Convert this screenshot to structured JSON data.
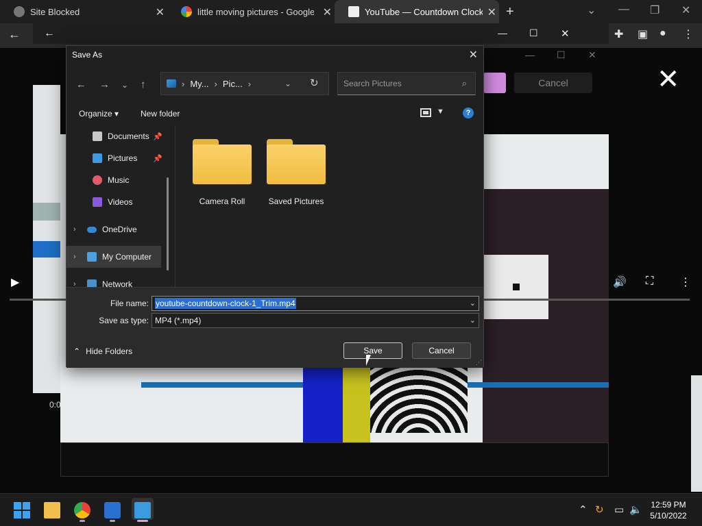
{
  "browser": {
    "tabs": [
      {
        "title": "Site Blocked",
        "color": "#888888"
      },
      {
        "title": "little moving pictures - Google S",
        "color": "#ffffff"
      },
      {
        "title": "YouTube — Countdown Clocks /",
        "color": "#e0e0e0"
      }
    ],
    "new_tab": "+"
  },
  "editor": {
    "cancel_label": "Cancel",
    "time": "0:0"
  },
  "dialog": {
    "title": "Save As",
    "breadcrumb": [
      "My...",
      "Pic...",
      ""
    ],
    "search_placeholder": "Search Pictures",
    "organize_label": "Organize",
    "new_folder_label": "New folder",
    "help_label": "?",
    "sidebar": [
      {
        "label": "Documents",
        "pinned": true,
        "color": "#c8c8c8"
      },
      {
        "label": "Pictures",
        "pinned": true,
        "color": "#3a9be0"
      },
      {
        "label": "Music",
        "pinned": false,
        "color": "#e05a6a"
      },
      {
        "label": "Videos",
        "pinned": false,
        "color": "#8a5ad8"
      },
      {
        "label": "OneDrive",
        "pinned": false,
        "color": "#2a8ae0"
      },
      {
        "label": "My Computer",
        "pinned": false,
        "color": "#4aa0e0"
      },
      {
        "label": "Network",
        "pinned": false,
        "color": "#4a90c8"
      }
    ],
    "folders": [
      "Camera Roll",
      "Saved Pictures"
    ],
    "file_name_label": "File name:",
    "file_name_value": "youtube-countdown-clock-1_Trim.mp4",
    "save_type_label": "Save as type:",
    "save_type_value": "MP4 (*.mp4)",
    "hide_folders_label": "Hide Folders",
    "save_label": "Save",
    "cancel_label": "Cancel"
  },
  "taskbar": {
    "time": "12:59 PM",
    "date": "5/10/2022"
  }
}
